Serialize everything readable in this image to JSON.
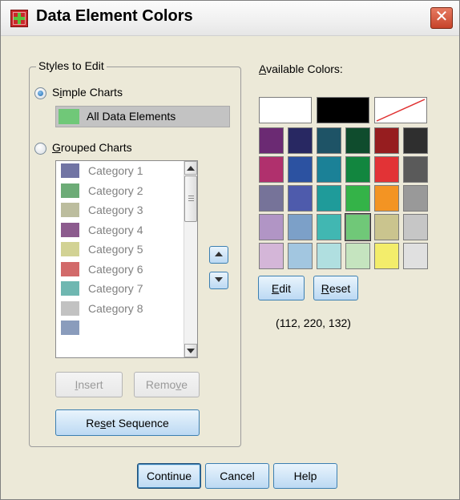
{
  "window": {
    "title": "Data Element Colors",
    "close_glyph": "✕"
  },
  "styles_group": {
    "legend": "Styles to Edit",
    "simple": {
      "label_prefix": "S",
      "label_underline": "i",
      "label_suffix": "mple Charts",
      "checked": true,
      "element_label": "All Data Elements",
      "element_color": "#70c878"
    },
    "grouped": {
      "label_underline": "G",
      "label_suffix": "rouped Charts",
      "checked": false,
      "categories": [
        {
          "label": "Category 1",
          "color": "#7174a4"
        },
        {
          "label": "Category 2",
          "color": "#6dac77"
        },
        {
          "label": "Category 3",
          "color": "#bcbd9e"
        },
        {
          "label": "Category 4",
          "color": "#8c5b8e"
        },
        {
          "label": "Category 5",
          "color": "#d2d294"
        },
        {
          "label": "Category 6",
          "color": "#d26a6a"
        },
        {
          "label": "Category 7",
          "color": "#6fb7b1"
        },
        {
          "label": "Category 8",
          "color": "#c2c2c2"
        },
        {
          "label": "",
          "color": "#8a9cbc"
        }
      ]
    },
    "insert_label_prefix": "I",
    "insert_label_suffix": "nsert",
    "remove_label_prefix": "Remo",
    "remove_label_underline": "v",
    "remove_label_suffix": "e",
    "reset_sequence_prefix": "Re",
    "reset_sequence_underline": "s",
    "reset_sequence_suffix": "et Sequence",
    "move_up_icon": "triangle-up-icon",
    "move_down_icon": "triangle-down-icon"
  },
  "colors_panel": {
    "label_underline": "A",
    "label_suffix": "vailable Colors:",
    "top_row": [
      "#ffffff",
      "#000000",
      "none"
    ],
    "grid": [
      [
        "#6b2a73",
        "#282862",
        "#1e5366",
        "#0f4c2d",
        "#961d1f",
        "#2f2f2f"
      ],
      [
        "#b0306d",
        "#2c52a1",
        "#1b8197",
        "#12863f",
        "#e23336",
        "#5a5a5a"
      ],
      [
        "#767399",
        "#4e5bac",
        "#1f9b9a",
        "#34b348",
        "#f39423",
        "#999999"
      ],
      [
        "#b195c5",
        "#7ca0c8",
        "#41b7b2",
        "#70c878",
        "#cac48e",
        "#c6c6c6"
      ],
      [
        "#d4b6d8",
        "#a2c6e0",
        "#b0dfe0",
        "#c5e4bf",
        "#f3ed6b",
        "#e0e0e0"
      ]
    ],
    "selected_row": 3,
    "selected_col": 3,
    "edit_prefix": "",
    "edit_underline": "E",
    "edit_suffix": "dit",
    "reset_underline": "R",
    "reset_suffix": "eset",
    "rgb_readout": "(112, 220, 132)"
  },
  "footer": {
    "continue_label": "Continue",
    "cancel_label": "Cancel",
    "help_label": "Help"
  }
}
